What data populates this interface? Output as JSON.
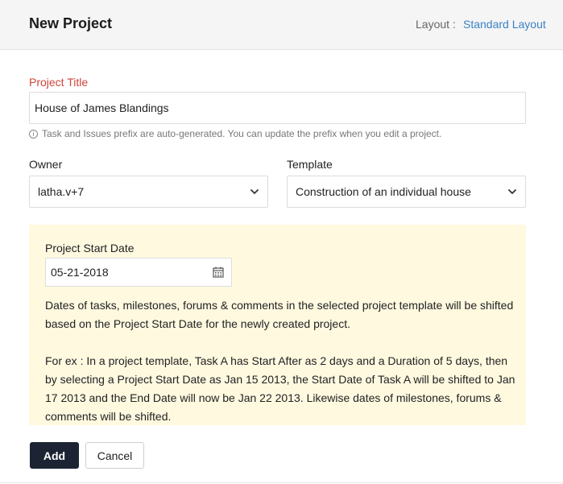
{
  "header": {
    "title": "New Project",
    "layout_label": "Layout :",
    "layout_value": "Standard Layout"
  },
  "form": {
    "project_title": {
      "label": "Project Title",
      "value": "House of James Blandings"
    },
    "hint": "Task and Issues prefix are auto-generated. You can update the prefix when you edit a project.",
    "owner": {
      "label": "Owner",
      "value": "latha.v+7"
    },
    "template": {
      "label": "Template",
      "value": "Construction of an individual house"
    },
    "start_date": {
      "label": "Project Start Date",
      "value": "05-21-2018"
    },
    "description_1": "Dates of tasks, milestones, forums & comments in the selected project template will be shifted based on the Project Start Date for the newly created project.",
    "description_2": "For ex : In a project template, Task A has Start After as 2 days and a Duration of 5 days, then by selecting a Project Start Date as Jan 15 2013, the Start Date of Task A will be shifted to Jan 17 2013 and the End Date will now be Jan 22 2013. Likewise dates of milestones, forums & comments will be shifted."
  },
  "actions": {
    "add_label": "Add",
    "cancel_label": "Cancel"
  },
  "icons": {
    "info": "info-icon",
    "chevron": "chevron-down-icon",
    "calendar": "calendar-icon"
  },
  "colors": {
    "required_label": "#d0443b",
    "link": "#3b82c4",
    "info_box_bg": "#fff9e0",
    "primary_button": "#1c2433"
  }
}
